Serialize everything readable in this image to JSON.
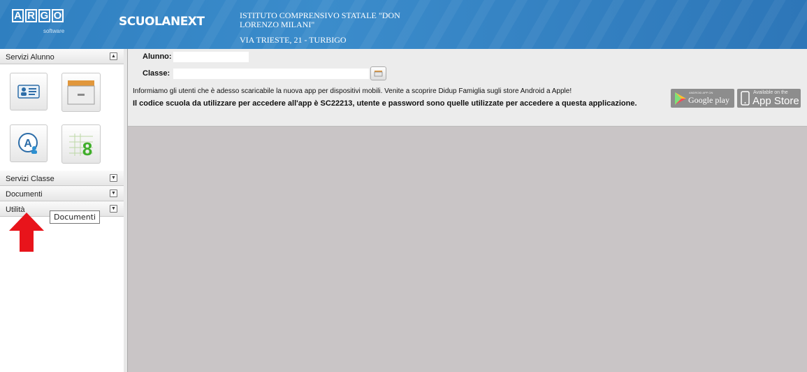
{
  "header": {
    "logo_letters": [
      "A",
      "R",
      "G",
      "O"
    ],
    "logo_sub": "software",
    "app_name": "SCUOLANEXT",
    "school_name": "ISTITUTO COMPRENSIVO STATALE \"DON LORENZO MILANI\"",
    "school_address": "VIA TRIESTE, 21 - TURBIGO"
  },
  "sidebar": {
    "panels": [
      {
        "label": "Servizi Alunno",
        "toggle": "collapse"
      },
      {
        "label": "Servizi Classe",
        "toggle": "expand"
      },
      {
        "label": "Documenti",
        "toggle": "expand"
      },
      {
        "label": "Utilità",
        "toggle": "expand"
      }
    ],
    "tiles": [
      "student-card-icon",
      "archive-icon",
      "a-user-icon",
      "calendar-8-icon"
    ]
  },
  "form": {
    "alunno_label": "Alunno:",
    "alunno_value": "",
    "classe_label": "Classe:",
    "classe_value": ""
  },
  "notice": {
    "line1": "Informiamo gli utenti che è adesso scaricabile la nuova app per dispositivi mobili. Venite a scoprire Didup Famiglia sugli store Android a Apple!",
    "line2": "Il codice scuola da utilizzare per accedere all'app è SC22213, utente e password sono quelle utilizzate per accedere a questa applicazione."
  },
  "badges": {
    "google_small": "ANDROID APP ON",
    "google_label": "Google play",
    "apple_small": "Available on the",
    "apple_label": "App Store"
  },
  "tooltip": "Documenti",
  "colors": {
    "header": "#2f7fc0",
    "arrow": "#e8141b",
    "main_bg": "#c9c5c6"
  }
}
